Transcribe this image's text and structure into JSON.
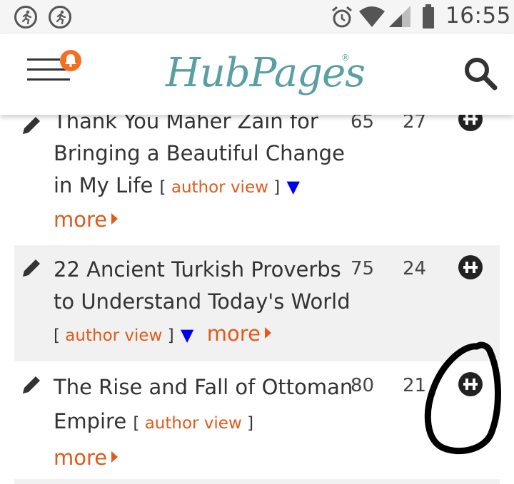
{
  "status_bar": {
    "time": "16:55",
    "icons": [
      "running-person-icon",
      "running-person-icon",
      "alarm-icon",
      "wifi-icon",
      "signal-icon",
      "battery-icon"
    ]
  },
  "header": {
    "logo_text": "HubPages",
    "logo_mark": "®",
    "menu_icon": "hamburger-menu-icon",
    "notification_icon": "bell-icon",
    "search_icon": "search-icon"
  },
  "colors": {
    "accent_orange": "#e05a1c",
    "logo_teal": "#5a9fa3",
    "badge_orange": "#f37021",
    "triangle_blue": "#0000ee",
    "row_alt_bg": "#f1f1f1"
  },
  "articles": [
    {
      "title_line1": "Thank You Maher Zain for",
      "title_line2": "Bringing a Beautiful Change",
      "title_line3": "in My Life",
      "bracket_open": "[",
      "author_view": "author view",
      "bracket_close": "]",
      "triangle": "▼",
      "more": "more",
      "score": "65",
      "count": "27"
    },
    {
      "title_line1": "22 Ancient Turkish Proverbs",
      "title_line2": "to Understand Today's World",
      "bracket_open": "[",
      "author_view": "author view",
      "bracket_close": "]",
      "triangle": "▼",
      "more": "more",
      "score": "75",
      "count": "24"
    },
    {
      "title_line1": "The Rise and Fall of Ottoman",
      "title_line2": "Empire",
      "bracket_open": "[",
      "author_view": "author view",
      "bracket_close": "]",
      "more": "more",
      "score": "80",
      "count": "21"
    }
  ]
}
